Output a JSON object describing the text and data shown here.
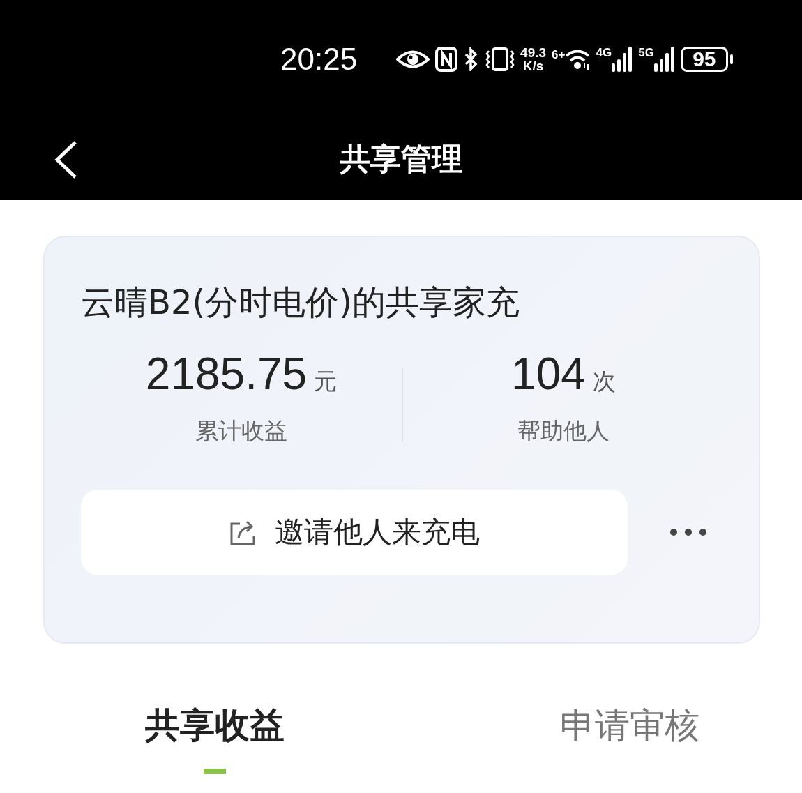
{
  "status_bar": {
    "time": "20:25",
    "net_speed": [
      "49.3",
      "K/s"
    ],
    "wifi_label": "6+",
    "signals": [
      {
        "label": "4G"
      },
      {
        "label": "5G"
      }
    ],
    "battery": "95"
  },
  "nav": {
    "title": "共享管理"
  },
  "card": {
    "title": "云晴B2(分时电价)的共享家充",
    "stats": [
      {
        "value": "2185.75",
        "unit": "元",
        "label": "累计收益"
      },
      {
        "value": "104",
        "unit": "次",
        "label": "帮助他人"
      }
    ],
    "invite_button": "邀请他人来充电"
  },
  "tabs": [
    {
      "label": "共享收益",
      "selected": true
    },
    {
      "label": "申请审核",
      "selected": false
    }
  ]
}
